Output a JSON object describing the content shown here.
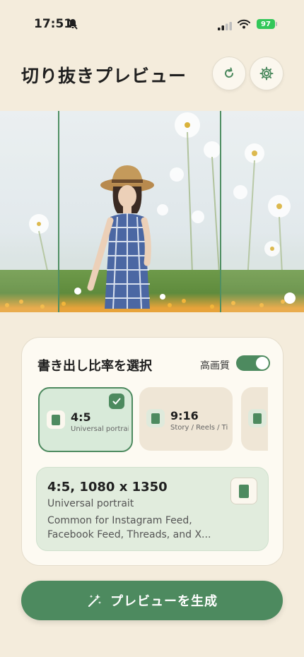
{
  "status_bar": {
    "time": "17:51",
    "battery": "97"
  },
  "header": {
    "title": "切り抜きプレビュー"
  },
  "export": {
    "title": "書き出し比率を選択",
    "high_quality_label": "高画質",
    "high_quality_on": true,
    "ratios": [
      {
        "name": "4:5",
        "sub": "Universal portrait",
        "selected": true
      },
      {
        "name": "9:16",
        "sub": "Story / Reels / TikTok",
        "selected": false
      },
      {
        "name": "",
        "sub": "",
        "selected": false
      }
    ],
    "detail": {
      "title": "4:5, 1080 x 1350",
      "subtitle": "Universal portrait",
      "description": "Common for Instagram Feed, Facebook Feed, Threads, and X..."
    }
  },
  "generate_button": {
    "label": "プレビューを生成"
  },
  "colors": {
    "accent": "#4d8a5f",
    "background": "#f4ecdc",
    "card": "#fdfaf2"
  }
}
